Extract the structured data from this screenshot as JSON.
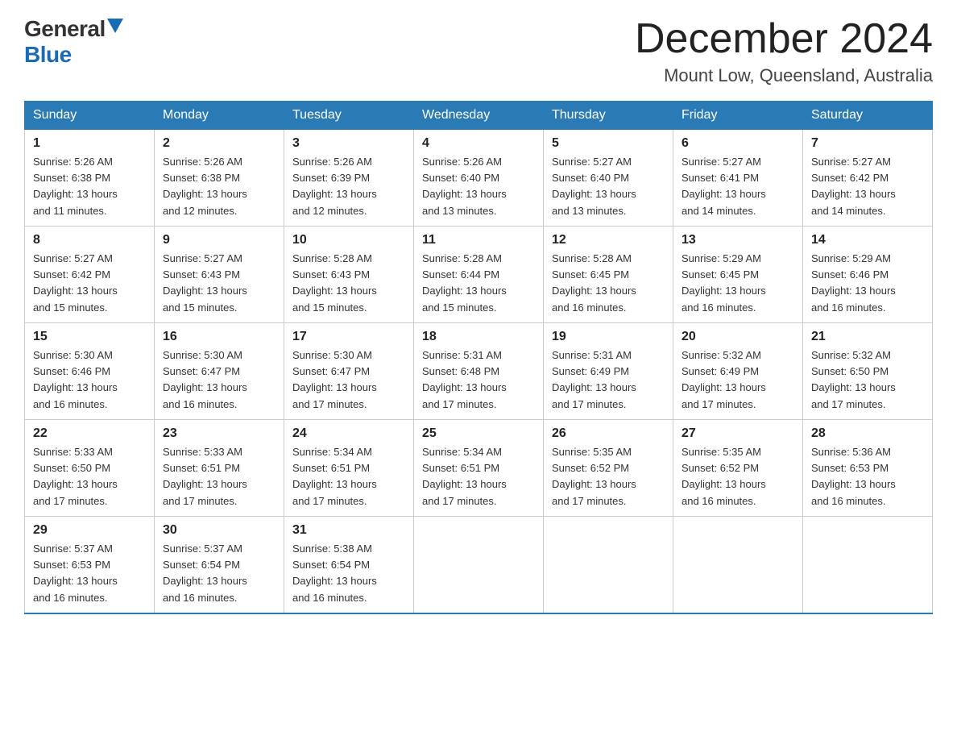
{
  "header": {
    "logo_general": "General",
    "logo_blue": "Blue",
    "month_title": "December 2024",
    "location": "Mount Low, Queensland, Australia"
  },
  "days_of_week": [
    "Sunday",
    "Monday",
    "Tuesday",
    "Wednesday",
    "Thursday",
    "Friday",
    "Saturday"
  ],
  "weeks": [
    [
      {
        "num": "1",
        "sunrise": "5:26 AM",
        "sunset": "6:38 PM",
        "daylight": "13 hours and 11 minutes."
      },
      {
        "num": "2",
        "sunrise": "5:26 AM",
        "sunset": "6:38 PM",
        "daylight": "13 hours and 12 minutes."
      },
      {
        "num": "3",
        "sunrise": "5:26 AM",
        "sunset": "6:39 PM",
        "daylight": "13 hours and 12 minutes."
      },
      {
        "num": "4",
        "sunrise": "5:26 AM",
        "sunset": "6:40 PM",
        "daylight": "13 hours and 13 minutes."
      },
      {
        "num": "5",
        "sunrise": "5:27 AM",
        "sunset": "6:40 PM",
        "daylight": "13 hours and 13 minutes."
      },
      {
        "num": "6",
        "sunrise": "5:27 AM",
        "sunset": "6:41 PM",
        "daylight": "13 hours and 14 minutes."
      },
      {
        "num": "7",
        "sunrise": "5:27 AM",
        "sunset": "6:42 PM",
        "daylight": "13 hours and 14 minutes."
      }
    ],
    [
      {
        "num": "8",
        "sunrise": "5:27 AM",
        "sunset": "6:42 PM",
        "daylight": "13 hours and 15 minutes."
      },
      {
        "num": "9",
        "sunrise": "5:27 AM",
        "sunset": "6:43 PM",
        "daylight": "13 hours and 15 minutes."
      },
      {
        "num": "10",
        "sunrise": "5:28 AM",
        "sunset": "6:43 PM",
        "daylight": "13 hours and 15 minutes."
      },
      {
        "num": "11",
        "sunrise": "5:28 AM",
        "sunset": "6:44 PM",
        "daylight": "13 hours and 15 minutes."
      },
      {
        "num": "12",
        "sunrise": "5:28 AM",
        "sunset": "6:45 PM",
        "daylight": "13 hours and 16 minutes."
      },
      {
        "num": "13",
        "sunrise": "5:29 AM",
        "sunset": "6:45 PM",
        "daylight": "13 hours and 16 minutes."
      },
      {
        "num": "14",
        "sunrise": "5:29 AM",
        "sunset": "6:46 PM",
        "daylight": "13 hours and 16 minutes."
      }
    ],
    [
      {
        "num": "15",
        "sunrise": "5:30 AM",
        "sunset": "6:46 PM",
        "daylight": "13 hours and 16 minutes."
      },
      {
        "num": "16",
        "sunrise": "5:30 AM",
        "sunset": "6:47 PM",
        "daylight": "13 hours and 16 minutes."
      },
      {
        "num": "17",
        "sunrise": "5:30 AM",
        "sunset": "6:47 PM",
        "daylight": "13 hours and 17 minutes."
      },
      {
        "num": "18",
        "sunrise": "5:31 AM",
        "sunset": "6:48 PM",
        "daylight": "13 hours and 17 minutes."
      },
      {
        "num": "19",
        "sunrise": "5:31 AM",
        "sunset": "6:49 PM",
        "daylight": "13 hours and 17 minutes."
      },
      {
        "num": "20",
        "sunrise": "5:32 AM",
        "sunset": "6:49 PM",
        "daylight": "13 hours and 17 minutes."
      },
      {
        "num": "21",
        "sunrise": "5:32 AM",
        "sunset": "6:50 PM",
        "daylight": "13 hours and 17 minutes."
      }
    ],
    [
      {
        "num": "22",
        "sunrise": "5:33 AM",
        "sunset": "6:50 PM",
        "daylight": "13 hours and 17 minutes."
      },
      {
        "num": "23",
        "sunrise": "5:33 AM",
        "sunset": "6:51 PM",
        "daylight": "13 hours and 17 minutes."
      },
      {
        "num": "24",
        "sunrise": "5:34 AM",
        "sunset": "6:51 PM",
        "daylight": "13 hours and 17 minutes."
      },
      {
        "num": "25",
        "sunrise": "5:34 AM",
        "sunset": "6:51 PM",
        "daylight": "13 hours and 17 minutes."
      },
      {
        "num": "26",
        "sunrise": "5:35 AM",
        "sunset": "6:52 PM",
        "daylight": "13 hours and 17 minutes."
      },
      {
        "num": "27",
        "sunrise": "5:35 AM",
        "sunset": "6:52 PM",
        "daylight": "13 hours and 16 minutes."
      },
      {
        "num": "28",
        "sunrise": "5:36 AM",
        "sunset": "6:53 PM",
        "daylight": "13 hours and 16 minutes."
      }
    ],
    [
      {
        "num": "29",
        "sunrise": "5:37 AM",
        "sunset": "6:53 PM",
        "daylight": "13 hours and 16 minutes."
      },
      {
        "num": "30",
        "sunrise": "5:37 AM",
        "sunset": "6:54 PM",
        "daylight": "13 hours and 16 minutes."
      },
      {
        "num": "31",
        "sunrise": "5:38 AM",
        "sunset": "6:54 PM",
        "daylight": "13 hours and 16 minutes."
      },
      null,
      null,
      null,
      null
    ]
  ],
  "labels": {
    "sunrise": "Sunrise:",
    "sunset": "Sunset:",
    "daylight": "Daylight:"
  }
}
